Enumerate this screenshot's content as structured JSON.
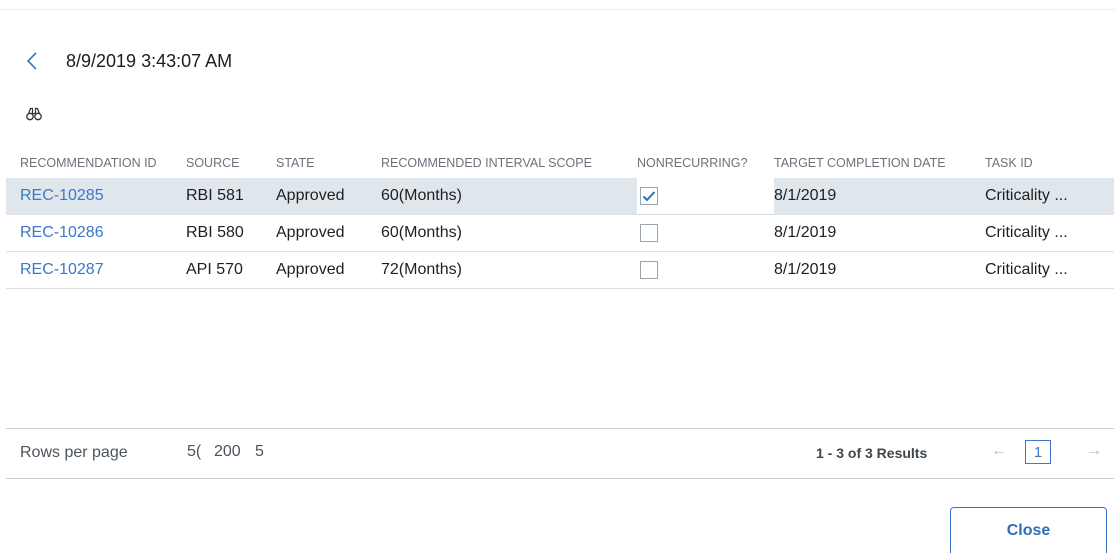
{
  "header": {
    "title": "8/9/2019 3:43:07 AM",
    "back_icon": "chevron-left-icon",
    "find_icon": "binoculars-icon"
  },
  "table": {
    "columns": [
      "RECOMMENDATION ID",
      "SOURCE",
      "STATE",
      "RECOMMENDED INTERVAL SCOPE",
      "NONRECURRING?",
      "TARGET COMPLETION DATE",
      "TASK ID"
    ],
    "rows": [
      {
        "id": "REC-10285",
        "source": "RBI 581",
        "state": "Approved",
        "interval": "60(Months)",
        "nonrecurring": true,
        "target_date": "8/1/2019",
        "task_id": "Criticality ..."
      },
      {
        "id": "REC-10286",
        "source": "RBI 580",
        "state": "Approved",
        "interval": "60(Months)",
        "nonrecurring": false,
        "target_date": "8/1/2019",
        "task_id": "Criticality ..."
      },
      {
        "id": "REC-10287",
        "source": "API 570",
        "state": "Approved",
        "interval": "72(Months)",
        "nonrecurring": false,
        "target_date": "8/1/2019",
        "task_id": "Criticality ..."
      }
    ],
    "selected_row": 0
  },
  "footer": {
    "rows_per_page_label": "Rows per page",
    "page_size_options": [
      "5(",
      "200",
      "5"
    ],
    "results_text": "1 - 3 of 3 Results",
    "current_page": "1",
    "prev_icon": "arrow-left-icon",
    "next_icon": "arrow-right-icon"
  },
  "close_label": "Close",
  "colors": {
    "accent": "#3b78c9",
    "selected_row": "#dfe6ec"
  }
}
